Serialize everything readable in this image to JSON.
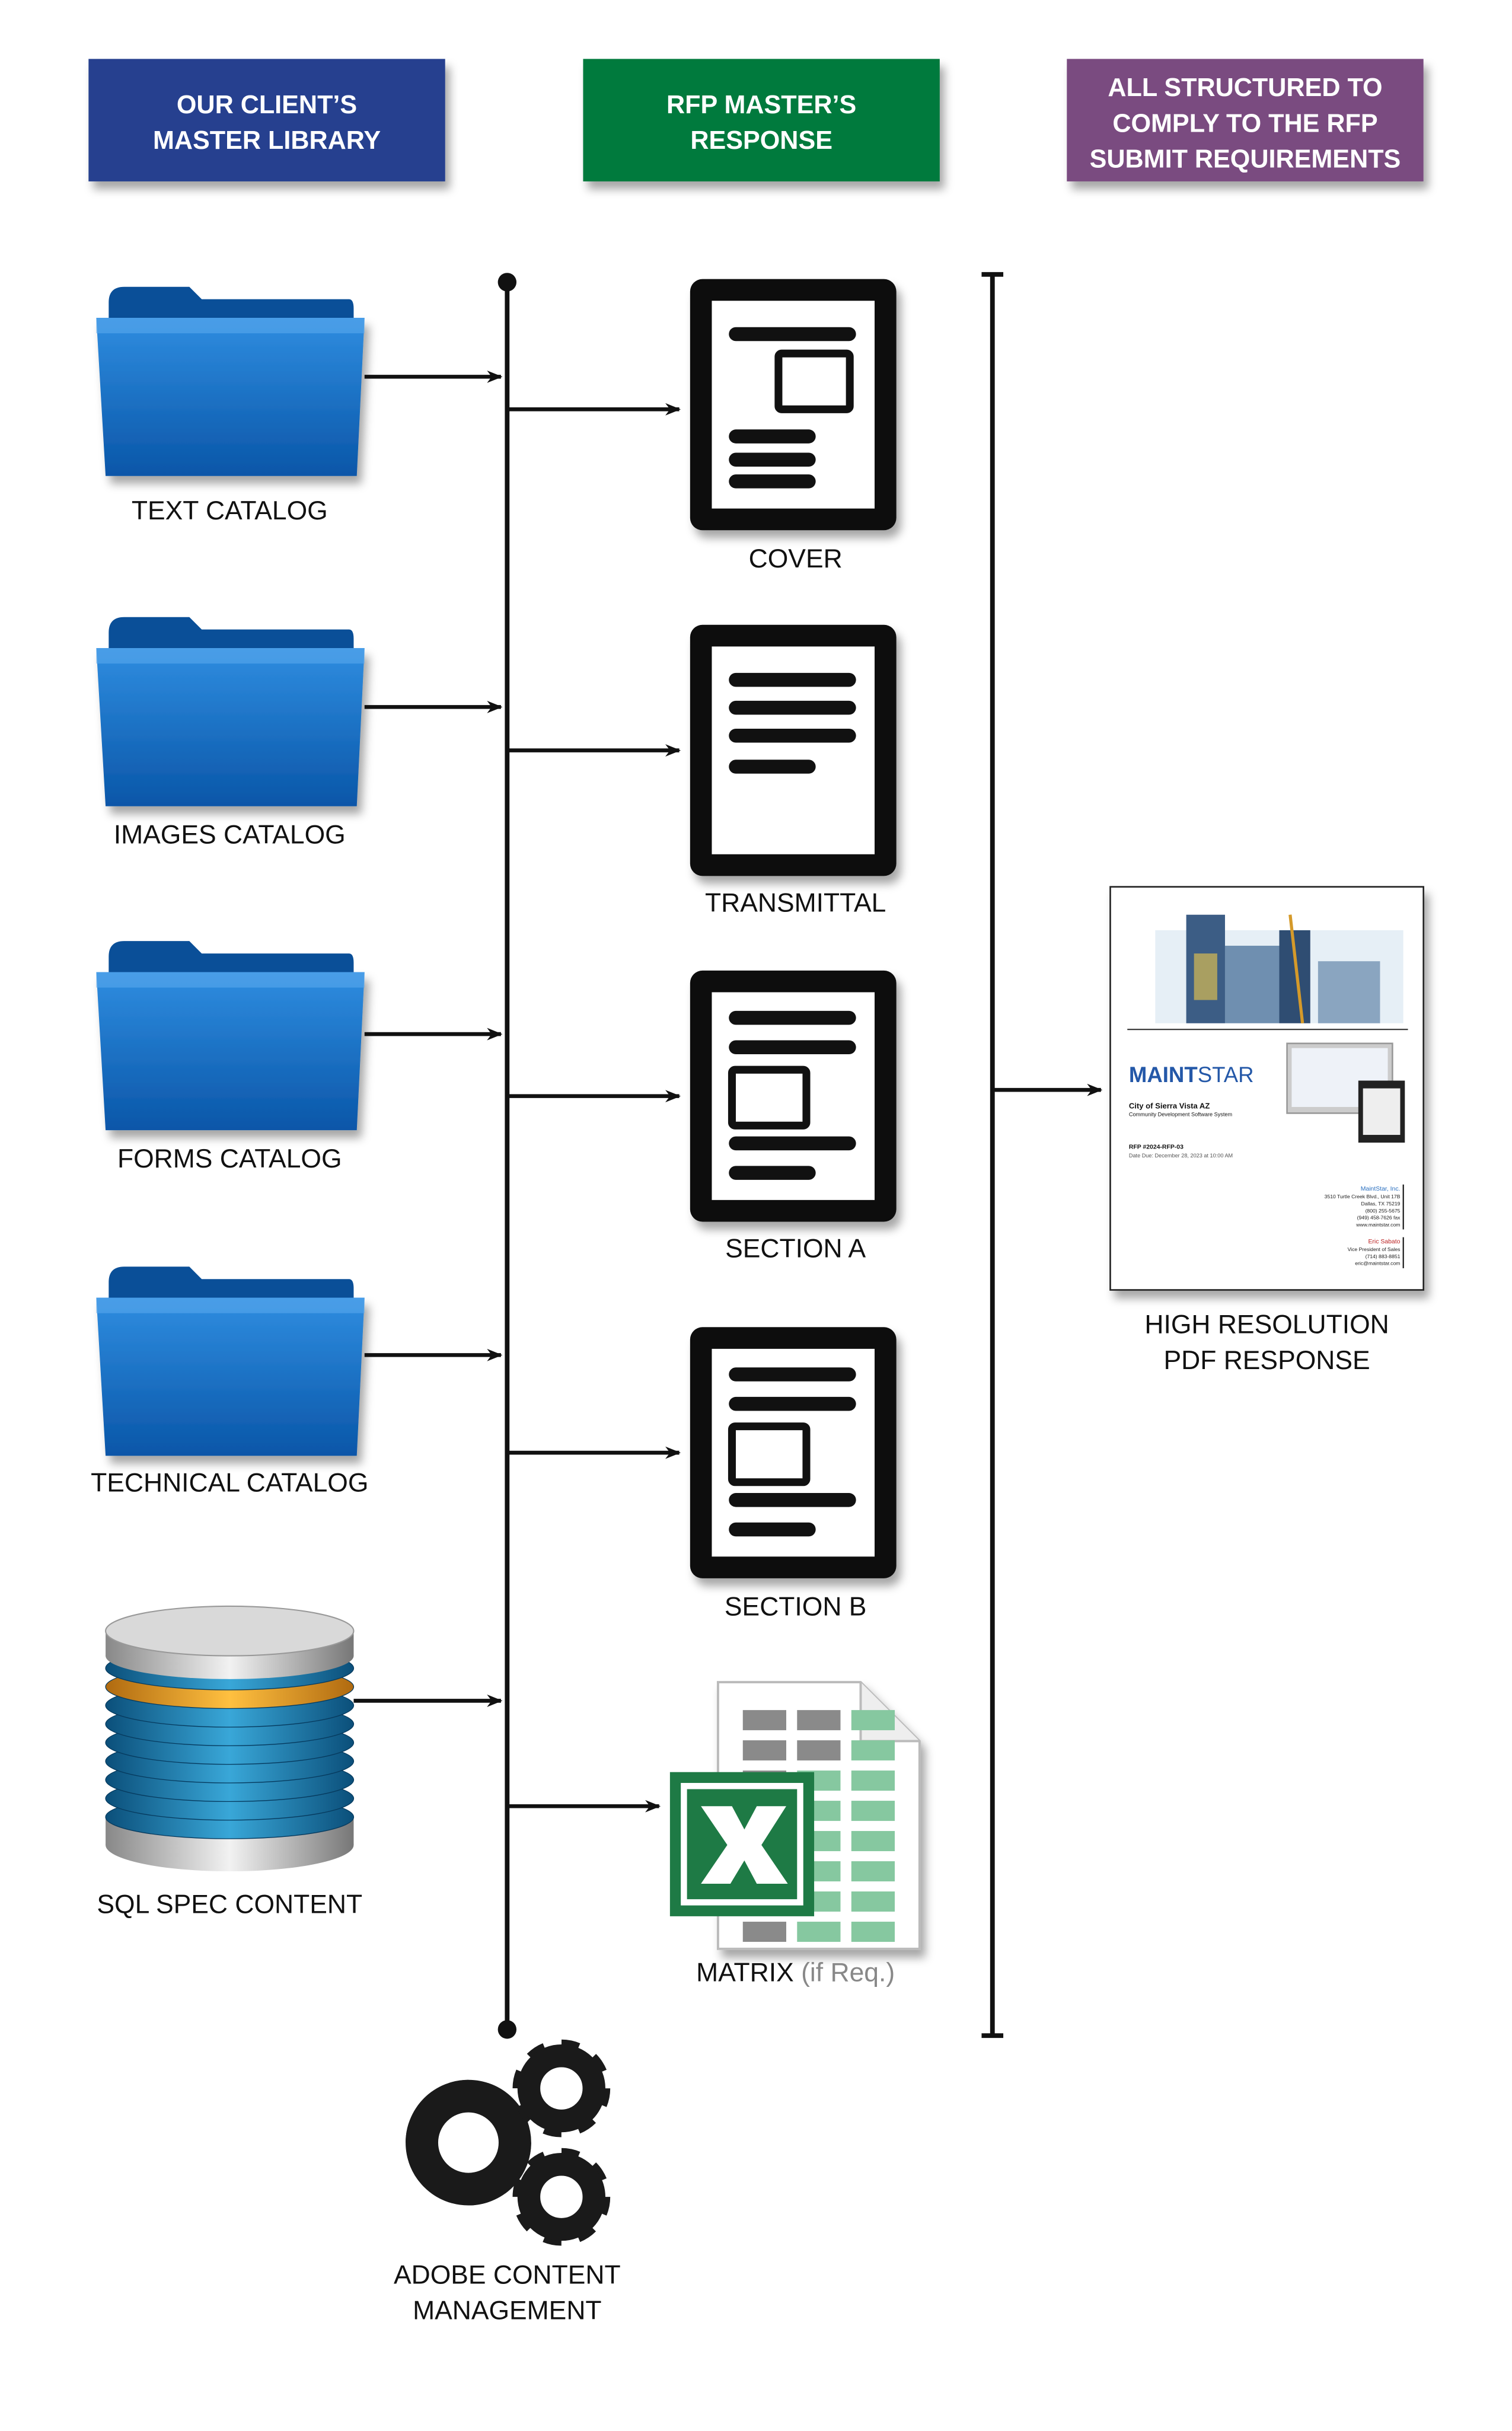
{
  "colors": {
    "client_header": "#25408f",
    "rfp_header": "#007a3d",
    "structured_header": "#7a4b80",
    "folder": "#0a5fb0",
    "excel": "#1e7a45"
  },
  "headers": {
    "client": [
      "OUR CLIENT’S",
      "MASTER LIBRARY"
    ],
    "rfp": [
      "RFP MASTER’S",
      "RESPONSE"
    ],
    "structured": [
      "ALL STRUCTURED TO",
      "COMPLY TO THE RFP",
      "SUBMIT REQUIREMENTS"
    ]
  },
  "library": [
    {
      "label": "TEXT CATALOG",
      "icon": "folder-icon"
    },
    {
      "label": "IMAGES CATALOG",
      "icon": "folder-icon"
    },
    {
      "label": "FORMS CATALOG",
      "icon": "folder-icon"
    },
    {
      "label": "TECHNICAL CATALOG",
      "icon": "folder-icon"
    },
    {
      "label": "SQL SPEC CONTENT",
      "icon": "database-icon"
    }
  ],
  "response": [
    {
      "label": "COVER",
      "icon": "document-icon"
    },
    {
      "label": "TRANSMITTAL",
      "icon": "document-icon"
    },
    {
      "label": "SECTION A",
      "icon": "document-icon"
    },
    {
      "label": "SECTION B",
      "icon": "document-icon"
    }
  ],
  "matrix": {
    "label": "MATRIX",
    "note": "(if Req.)",
    "icon": "excel-spreadsheet-icon"
  },
  "adobe": {
    "label": [
      "ADOBE CONTENT",
      "MANAGEMENT"
    ],
    "icon": "gears-icon"
  },
  "output": {
    "label": [
      "HIGH RESOLUTION",
      "PDF RESPONSE"
    ],
    "thumbnail": {
      "brand_bold": "MAINT",
      "brand_light": "STAR",
      "client": "City of Sierra Vista AZ",
      "project": "Community Development Software System",
      "rfp": "RFP #2024-RFP-03",
      "due": "Date Due:  December 28, 2023 at 10:00 AM",
      "company": "MaintStar, Inc.",
      "address": [
        "3510 Turtle Creek Blvd., Unit 17B",
        "Dallas, TX 75219",
        "(800) 255-5675",
        "(949) 458-7626 fax",
        "www.maintstar.com"
      ],
      "contact": "Eric Sabato",
      "contact_info": [
        "Vice President of Sales",
        "(714) 883-8851",
        "eric@maintstar.com"
      ]
    }
  }
}
